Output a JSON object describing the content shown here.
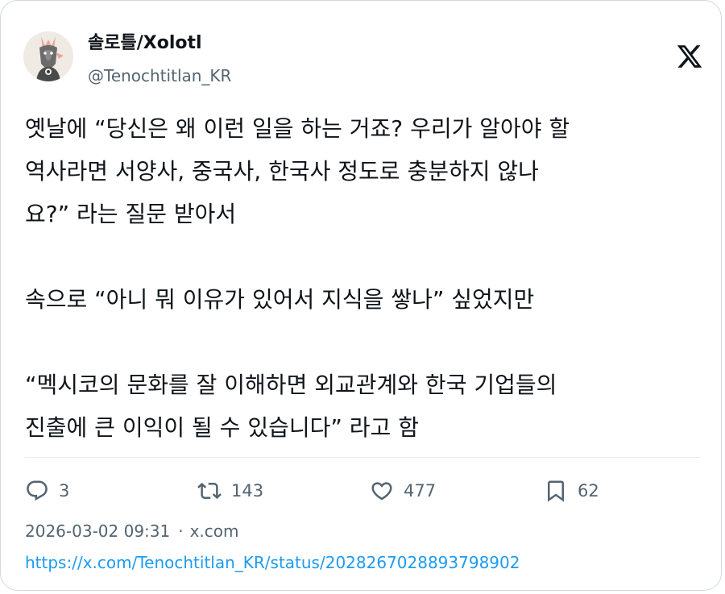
{
  "author": {
    "display_name": "솔로틀/Xolotl",
    "handle": "@Tenochtitlan_KR",
    "avatar_icon": "avatar-icon"
  },
  "platform_icon": "x-logo-icon",
  "tweet": {
    "lines": [
      "옛날에 “당신은 왜 이런 일을 하는 거죠? 우리가 알아야 할",
      "역사라면 서양사, 중국사, 한국사 정도로 충분하지 않나",
      "요?” 라는 질문 받아서",
      "",
      "속으로 “아니 뭐 이유가 있어서 지식을 쌓나” 싶었지만",
      "",
      "“멕시코의 문화를 잘 이해하면 외교관계와 한국 기업들의",
      "진출에 큰 이익이 될 수 있습니다” 라고 함"
    ]
  },
  "actions": {
    "replies": "3",
    "reposts": "143",
    "likes": "477",
    "bookmarks": "62"
  },
  "meta": {
    "timestamp": "2026-03-02 09:31",
    "separator": "·",
    "source": "x.com"
  },
  "link": "https://x.com/Tenochtitlan_KR/status/2028267028893798902",
  "colors": {
    "text": "#0f1419",
    "secondary": "#536471",
    "link": "#1d9bf0",
    "border": "#cfd9de"
  }
}
